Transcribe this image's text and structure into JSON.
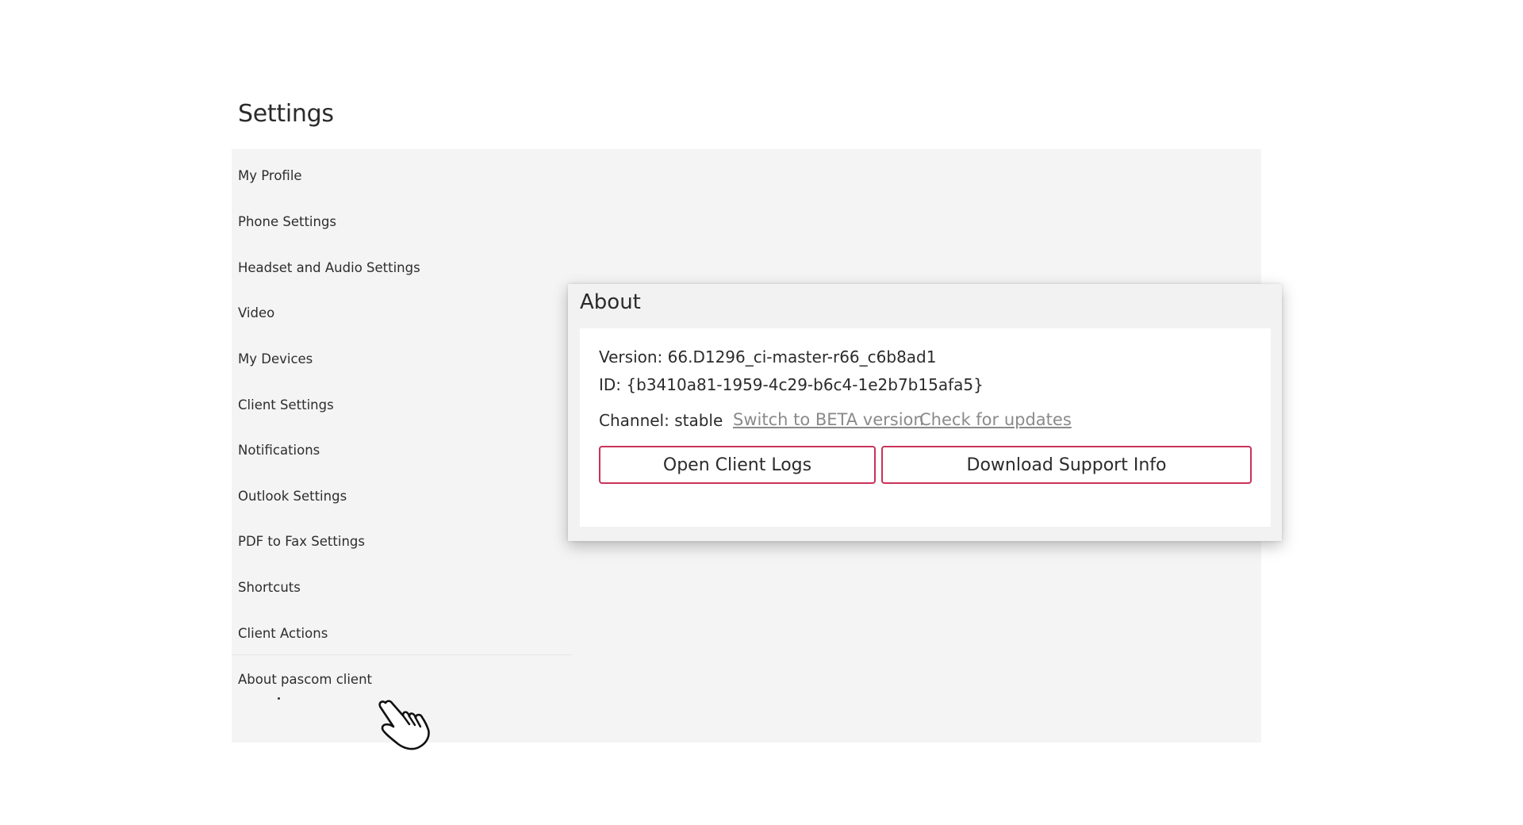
{
  "page": {
    "title": "Settings"
  },
  "sidebar": {
    "items": [
      {
        "label": "My Profile"
      },
      {
        "label": "Phone Settings"
      },
      {
        "label": "Headset and Audio Settings"
      },
      {
        "label": "Video"
      },
      {
        "label": "My Devices"
      },
      {
        "label": "Client Settings"
      },
      {
        "label": "Notifications"
      },
      {
        "label": "Outlook Settings"
      },
      {
        "label": "PDF to Fax Settings"
      },
      {
        "label": "Shortcuts"
      },
      {
        "label": "Client Actions"
      },
      {
        "label": "About pascom client"
      }
    ]
  },
  "about": {
    "title": "About",
    "version": "Version: 66.D1296_ci-master-r66_c6b8ad1",
    "id": "ID: {b3410a81-1959-4c29-b6c4-1e2b7b15afa5}",
    "channel": "Channel: stable",
    "switch_beta_link": "Switch to BETA version",
    "check_updates_link": "Check for updates",
    "open_logs_button": "Open Client Logs",
    "download_support_button": "Download Support Info"
  },
  "colors": {
    "accent_border": "#c8335a",
    "panel_background": "#f4f4f4",
    "link": "#8a8a8a"
  },
  "icons": {
    "cursor": "hand-pointer-icon"
  }
}
